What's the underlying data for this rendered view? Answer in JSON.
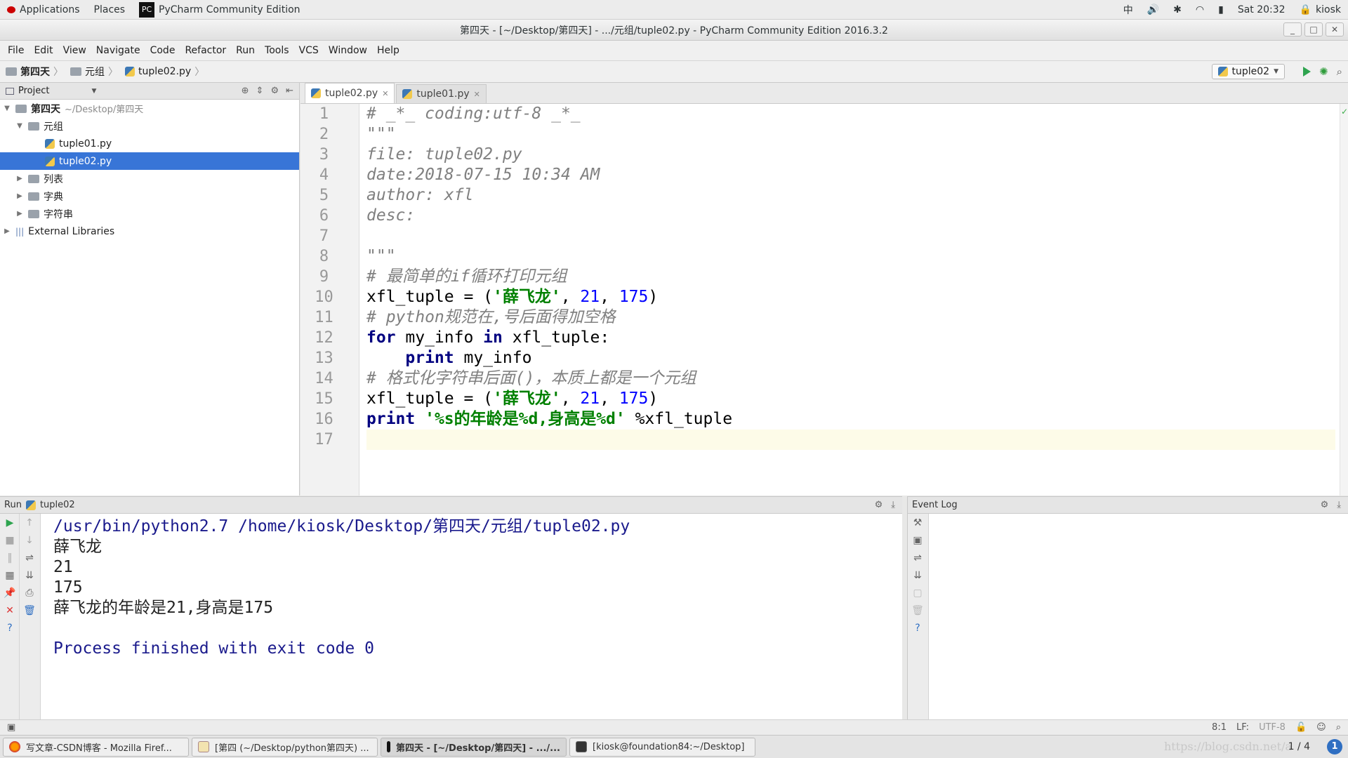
{
  "topbar": {
    "applications": "Applications",
    "places": "Places",
    "app_name": "PyCharm Community Edition",
    "ime": "中",
    "clock": "Sat 20:32",
    "user": "kiosk"
  },
  "window": {
    "title": "第四天 - [~/Desktop/第四天] - .../元组/tuple02.py - PyCharm Community Edition 2016.3.2"
  },
  "menu": [
    "File",
    "Edit",
    "View",
    "Navigate",
    "Code",
    "Refactor",
    "Run",
    "Tools",
    "VCS",
    "Window",
    "Help"
  ],
  "breadcrumb": [
    "第四天",
    "元组",
    "tuple02.py"
  ],
  "run_config": "tuple02",
  "project": {
    "header": "Project",
    "root_name": "第四天",
    "root_path": "~/Desktop/第四天",
    "folder_yuanzu": "元组",
    "file1": "tuple01.py",
    "file2": "tuple02.py",
    "folder_liebiao": "列表",
    "folder_zidian": "字典",
    "folder_zifuchuan": "字符串",
    "external": "External Libraries"
  },
  "tabs": [
    {
      "label": "tuple02.py"
    },
    {
      "label": "tuple01.py"
    }
  ],
  "code": {
    "line_numbers": [
      "1",
      "2",
      "3",
      "4",
      "5",
      "6",
      "7",
      "8",
      "9",
      "10",
      "11",
      "12",
      "13",
      "14",
      "15",
      "16",
      "17"
    ],
    "l1": "# _*_ coding:utf-8 _*_",
    "l2": "\"\"\"",
    "l3": "file: tuple02.py",
    "l4": "date:2018-07-15 10:34 AM",
    "l5": "author: xfl",
    "l6": "desc:",
    "l8": "\"\"\"",
    "l9": "# 最简单的if循环打印元组",
    "l10_a": "xfl_tuple = (",
    "l10_s": "'薛飞龙'",
    "l10_sep1": ", ",
    "l10_n1": "21",
    "l10_sep2": ", ",
    "l10_n2": "175",
    "l10_end": ")",
    "l11": "# python规范在,号后面得加空格",
    "l12_for": "for",
    "l12_mid": " my_info ",
    "l12_in": "in",
    "l12_end": " xfl_tuple:",
    "l13_indent": "    ",
    "l13_print": "print",
    "l13_end": " my_info",
    "l14": "# 格式化字符串后面()，本质上都是一个元组",
    "l15_a": "xfl_tuple = (",
    "l15_s": "'薛飞龙'",
    "l15_sep1": ", ",
    "l15_n1": "21",
    "l15_sep2": ", ",
    "l15_n2": "175",
    "l15_end": ")",
    "l16_print": "print",
    "l16_sp": " ",
    "l16_s": "'%s的年龄是%d,身高是%d'",
    "l16_end": " %xfl_tuple"
  },
  "run_panel": {
    "label": "Run",
    "config": "tuple02",
    "cmd": "/usr/bin/python2.7 /home/kiosk/Desktop/第四天/元组/tuple02.py",
    "out1": "薛飞龙",
    "out2": "21",
    "out3": "175",
    "out4": "薛飞龙的年龄是21,身高是175",
    "finished": "Process finished with exit code 0"
  },
  "event_log": {
    "label": "Event Log"
  },
  "status": {
    "position": "8:1",
    "line_sep": "LF:",
    "encoding": "UTF-8"
  },
  "taskbar": {
    "task1": "写文章-CSDN博客 - Mozilla Firef...",
    "task2": "[第四 (~/Desktop/python第四天) ...",
    "task3": "第四天 - [~/Desktop/第四天] - .../...",
    "task4": "[kiosk@foundation84:~/Desktop]",
    "watermark": "https://blog.csdn.net/a",
    "pager": "1 / 4"
  }
}
